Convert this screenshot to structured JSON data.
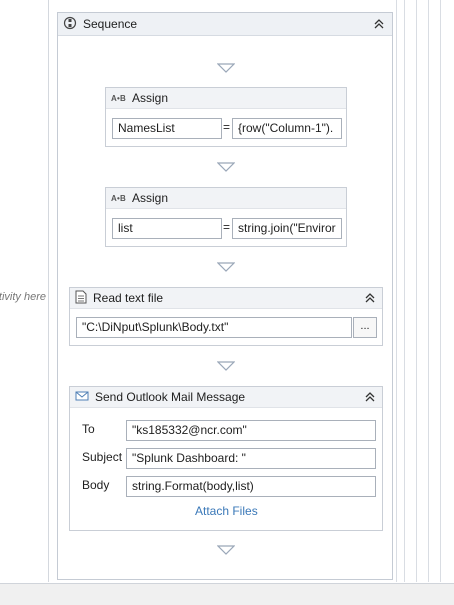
{
  "drop_hint": "Drop activity here",
  "sequence": {
    "title": "Sequence",
    "activities": {
      "assign1": {
        "title": "Assign",
        "icon_text": "A•B",
        "to_value": "NamesList",
        "equals": "=",
        "value": "{row(\"Column-1\")."
      },
      "assign2": {
        "title": "Assign",
        "icon_text": "A•B",
        "to_value": "list",
        "equals": "=",
        "value": "string.join(\"Enviror"
      },
      "read_text_file": {
        "title": "Read text file",
        "file_path": "\"C:\\DiNput\\Splunk\\Body.txt\"",
        "browse_label": "..."
      },
      "send_mail": {
        "title": "Send Outlook Mail Message",
        "to_label": "To",
        "to_value": "\"ks185332@ncr.com\"",
        "subject_label": "Subject",
        "subject_value": "\"Splunk Dashboard: \"",
        "body_label": "Body",
        "body_value": "string.Format(body,list)",
        "attach_label": "Attach Files"
      }
    }
  },
  "colors": {
    "accent_link": "#3a78b8",
    "border": "#c9ced6",
    "header_bg": "#f1f3f6"
  }
}
